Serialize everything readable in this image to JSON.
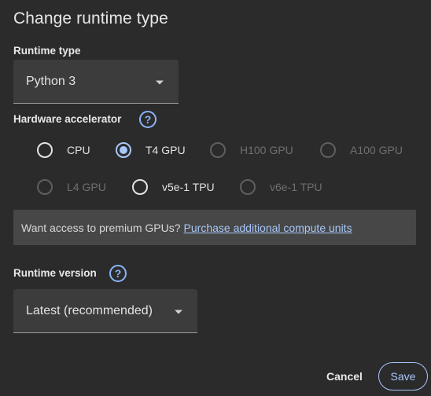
{
  "dialog": {
    "title": "Change runtime type"
  },
  "runtime_type": {
    "label": "Runtime type",
    "value": "Python 3"
  },
  "hardware_accelerator": {
    "label": "Hardware accelerator",
    "help": "?",
    "options": [
      {
        "label": "CPU",
        "checked": false,
        "disabled": false
      },
      {
        "label": "T4 GPU",
        "checked": true,
        "disabled": false
      },
      {
        "label": "H100 GPU",
        "checked": false,
        "disabled": true
      },
      {
        "label": "A100 GPU",
        "checked": false,
        "disabled": true
      },
      {
        "label": "L4 GPU",
        "checked": false,
        "disabled": true
      },
      {
        "label": "v5e-1 TPU",
        "checked": false,
        "disabled": false
      },
      {
        "label": "v6e-1 TPU",
        "checked": false,
        "disabled": true
      }
    ]
  },
  "notice": {
    "text": "Want access to premium GPUs?",
    "link": "Purchase additional compute units"
  },
  "runtime_version": {
    "label": "Runtime version",
    "help": "?",
    "value": "Latest (recommended)"
  },
  "actions": {
    "cancel": "Cancel",
    "save": "Save"
  },
  "colors": {
    "background": "#2b2b2b",
    "accent": "#a8c7fa",
    "select_bg": "#3c3c3c",
    "notice_bg": "#474747"
  }
}
